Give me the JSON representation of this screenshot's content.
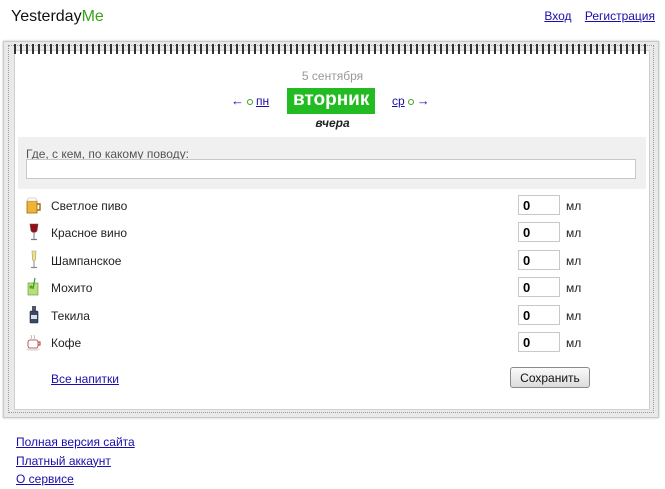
{
  "header": {
    "logo_part1": "Yesterday",
    "logo_part2": "Me",
    "login": "Вход",
    "register": "Регистрация"
  },
  "day": {
    "date": "5 сентября",
    "prev_label": "пн",
    "today_label": "вторник",
    "next_label": "ср",
    "relative": "вчера"
  },
  "note": {
    "label": "Где, с кем, по какому поводу:",
    "value": ""
  },
  "drinks": [
    {
      "name": "Светлое пиво",
      "value": "0",
      "unit": "мл",
      "icon": "beer-mug-icon"
    },
    {
      "name": "Красное вино",
      "value": "0",
      "unit": "мл",
      "icon": "wine-glass-icon"
    },
    {
      "name": "Шампанское",
      "value": "0",
      "unit": "мл",
      "icon": "champagne-glass-icon"
    },
    {
      "name": "Мохито",
      "value": "0",
      "unit": "мл",
      "icon": "cocktail-icon"
    },
    {
      "name": "Текила",
      "value": "0",
      "unit": "мл",
      "icon": "tequila-bottle-icon"
    },
    {
      "name": "Кофе",
      "value": "0",
      "unit": "мл",
      "icon": "coffee-cup-icon"
    }
  ],
  "actions": {
    "all_drinks": "Все напитки",
    "save": "Сохранить"
  },
  "footer": {
    "full_version": "Полная версия сайта",
    "paid_account": "Платный аккаунт",
    "about": "О сервисе"
  },
  "colors": {
    "brand_green": "#3aa11a",
    "today_bg": "#22bb22",
    "link": "#1a0dab"
  }
}
